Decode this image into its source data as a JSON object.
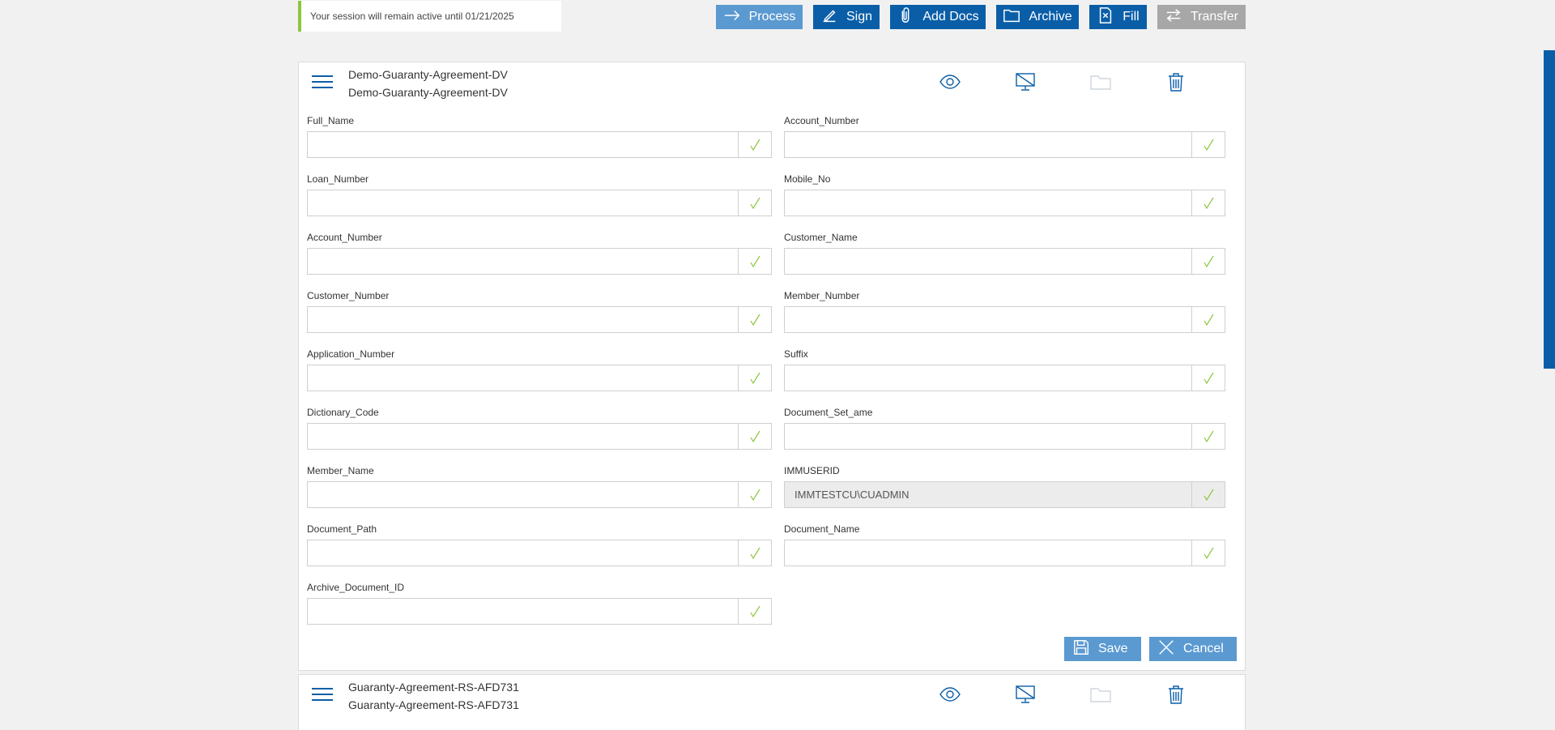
{
  "session": {
    "message": "Your session will remain active until 01/21/2025"
  },
  "colors": {
    "primary": "#0a5ea8",
    "primary_light": "#5b99d1",
    "disabled": "#a7a7a7",
    "check": "#8cc63f"
  },
  "toolbar": {
    "process": {
      "label": "Process",
      "icon": "arrow-right-icon"
    },
    "sign": {
      "label": "Sign",
      "icon": "pen-icon"
    },
    "add_docs": {
      "label": "Add Docs",
      "icon": "paperclip-icon"
    },
    "archive": {
      "label": "Archive",
      "icon": "folder-icon"
    },
    "fill": {
      "label": "Fill",
      "icon": "fill-document-icon"
    },
    "transfer": {
      "label": "Transfer",
      "icon": "transfer-arrows-icon"
    }
  },
  "documents": [
    {
      "title": "Demo-Guaranty-Agreement-DV",
      "subtitle": "Demo-Guaranty-Agreement-DV",
      "fields": [
        {
          "label": "Full_Name",
          "value": ""
        },
        {
          "label": "Account_Number",
          "value": ""
        },
        {
          "label": "Loan_Number",
          "value": ""
        },
        {
          "label": "Mobile_No",
          "value": ""
        },
        {
          "label": "Account_Number",
          "value": ""
        },
        {
          "label": "Customer_Name",
          "value": ""
        },
        {
          "label": "Customer_Number",
          "value": ""
        },
        {
          "label": "Member_Number",
          "value": ""
        },
        {
          "label": "Application_Number",
          "value": ""
        },
        {
          "label": "Suffix",
          "value": ""
        },
        {
          "label": "Dictionary_Code",
          "value": ""
        },
        {
          "label": "Document_Set_ame",
          "value": ""
        },
        {
          "label": "Member_Name",
          "value": ""
        },
        {
          "label": "IMMUSERID",
          "value": "IMMTESTCU\\CUADMIN"
        },
        {
          "label": "Document_Path",
          "value": ""
        },
        {
          "label": "Document_Name",
          "value": ""
        },
        {
          "label": "Archive_Document_ID",
          "value": ""
        }
      ],
      "save_label": "Save",
      "cancel_label": "Cancel"
    },
    {
      "title": "Guaranty-Agreement-RS-AFD731",
      "subtitle": "Guaranty-Agreement-RS-AFD731"
    }
  ]
}
